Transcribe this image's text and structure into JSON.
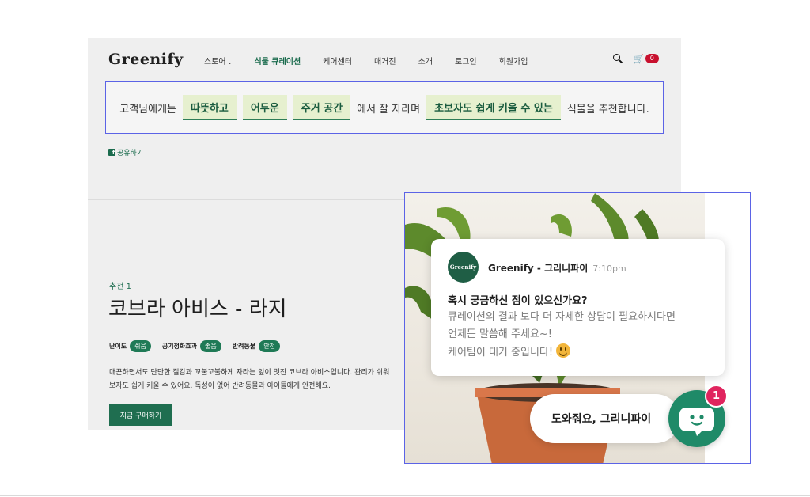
{
  "header": {
    "logo": "Greenify",
    "nav": [
      {
        "label": "스토어",
        "has_dropdown": true
      },
      {
        "label": "식물 큐레이션",
        "active": true
      },
      {
        "label": "케어센터"
      },
      {
        "label": "매거진"
      },
      {
        "label": "소개"
      },
      {
        "label": "로그인"
      },
      {
        "label": "회원가입"
      }
    ],
    "cart_count": "0"
  },
  "recommendation": {
    "prefix": "고객님에게는",
    "chips": [
      "따뜻하고",
      "어두운",
      "주거 공간",
      "초보자도 쉽게 키울 수 있는"
    ],
    "middle": "에서 잘 자라며",
    "suffix": "식물을 추천합니다."
  },
  "share": {
    "label": "공유하기"
  },
  "product": {
    "rec_number": "추천 1",
    "title": "코브라 아비스 - 라지",
    "tags": [
      {
        "label": "난이도",
        "value": "쉬움"
      },
      {
        "label": "공기정화효과",
        "value": "좋음"
      },
      {
        "label": "반려동물",
        "value": "안전"
      }
    ],
    "description_lines": [
      "매끈하면서도 단단한 질감과 꼬불꼬불하게 자라는 잎이 멋진 코브라 아비스입니다. 관리가 쉬워",
      "보자도 쉽게 키울 수 있어요. 독성이 없어 반려동물과 아이들에게 안전해요."
    ],
    "buy_label": "지금 구매하기"
  },
  "chat": {
    "avatar_text": "Greenify",
    "sender": "Greenify - 그리니파이",
    "time": "7:10pm",
    "question": "혹시 궁금하신 점이 있으신가요?",
    "lines": [
      "큐레이션의 결과 보다 더 자세한 상담이 필요하시다면",
      "언제든 말씀해 주세요~!",
      "케어팀이 대기 중입니다!"
    ],
    "help_label": "도와줘요, 그리니파이",
    "unread": "1"
  },
  "colors": {
    "brand_green": "#1f6e50",
    "chip_bg": "#e6f0cf",
    "badge_red": "#c8102e",
    "highlight_border": "#5b63e6",
    "fab_green": "#1f8a68",
    "unread_pink": "#e0245e"
  },
  "icons": [
    "search-icon",
    "cart-icon",
    "chevron-down-icon",
    "facebook-icon",
    "smile-emoji-icon",
    "chat-bot-icon"
  ]
}
